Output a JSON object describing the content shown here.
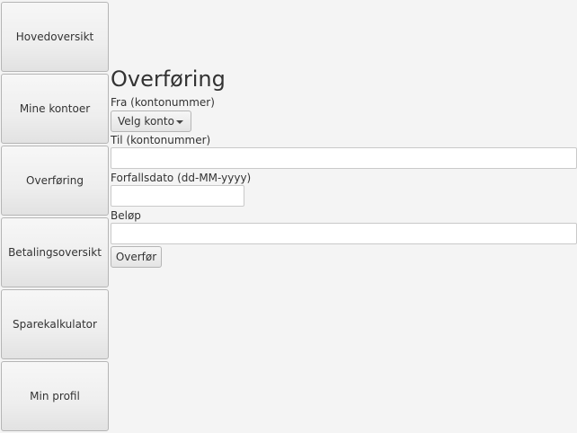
{
  "sidebar": {
    "items": [
      {
        "label": "Hovedoversikt"
      },
      {
        "label": "Mine kontoer"
      },
      {
        "label": "Overføring"
      },
      {
        "label": "Betalingsoversikt"
      },
      {
        "label": "Sparekalkulator"
      },
      {
        "label": "Min profil"
      }
    ]
  },
  "form": {
    "title": "Overføring",
    "from_label": "Fra (kontonummer)",
    "from_select": "Velg konto",
    "to_label": "Til (kontonummer)",
    "to_value": "",
    "due_label": "Forfallsdato (dd-MM-yyyy)",
    "due_value": "",
    "amount_label": "Beløp",
    "amount_value": "",
    "submit_label": "Overfør"
  }
}
